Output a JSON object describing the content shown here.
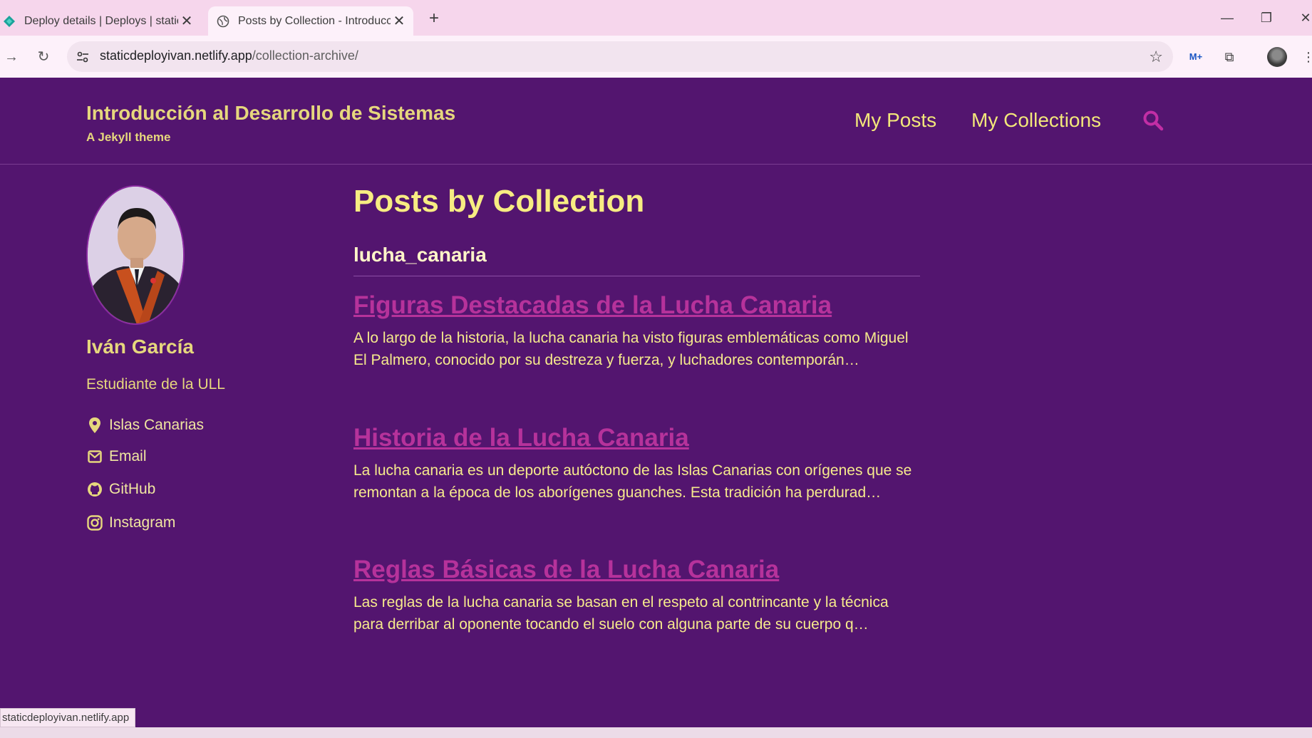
{
  "browser": {
    "tabs": [
      {
        "title": "Deploy details | Deploys | static",
        "close": "✕"
      },
      {
        "title": "Posts by Collection - Introducci",
        "close": "✕"
      }
    ],
    "new_tab": "+",
    "url_host": "staticdeployivan.netlify.app",
    "url_path": "/collection-archive/",
    "status_url": "staticdeployivan.netlify.app"
  },
  "site": {
    "title": "Introducción al Desarrollo de Sistemas",
    "subtitle": "A Jekyll theme",
    "nav": [
      {
        "label": "My Posts"
      },
      {
        "label": "My Collections"
      }
    ]
  },
  "author": {
    "name": "Iván García",
    "bio": "Estudiante de la ULL",
    "links": [
      {
        "icon": "map-marker-icon",
        "label": "Islas Canarias"
      },
      {
        "icon": "envelope-icon",
        "label": "Email"
      },
      {
        "icon": "github-icon",
        "label": "GitHub"
      },
      {
        "icon": "instagram-icon",
        "label": "Instagram"
      }
    ]
  },
  "main": {
    "page_title": "Posts by Collection",
    "collection": "lucha_canaria",
    "posts": [
      {
        "title": "Figuras Destacadas de la Lucha Canaria",
        "excerpt": "A lo largo de la historia, la lucha canaria ha visto figuras emblemáticas como Miguel El Palmero, conocido por su destreza y fuerza, y luchadores contemporán…"
      },
      {
        "title": "Historia de la Lucha Canaria",
        "excerpt": "La lucha canaria es un deporte autóctono de las Islas Canarias con orígenes que se remontan a la época de los aborígenes guanches. Esta tradición ha perdurad…"
      },
      {
        "title": "Reglas Básicas de la Lucha Canaria",
        "excerpt": "Las reglas de la lucha canaria se basan en el respeto al contrincante y la técnica para derribar al oponente tocando el suelo con alguna parte de su cuerpo q…"
      }
    ]
  },
  "colors": {
    "page_bg": "#53156f",
    "title_yellow": "#e6d77d",
    "link_magenta": "#b6329b",
    "chrome_pink": "#f6d6ec"
  }
}
